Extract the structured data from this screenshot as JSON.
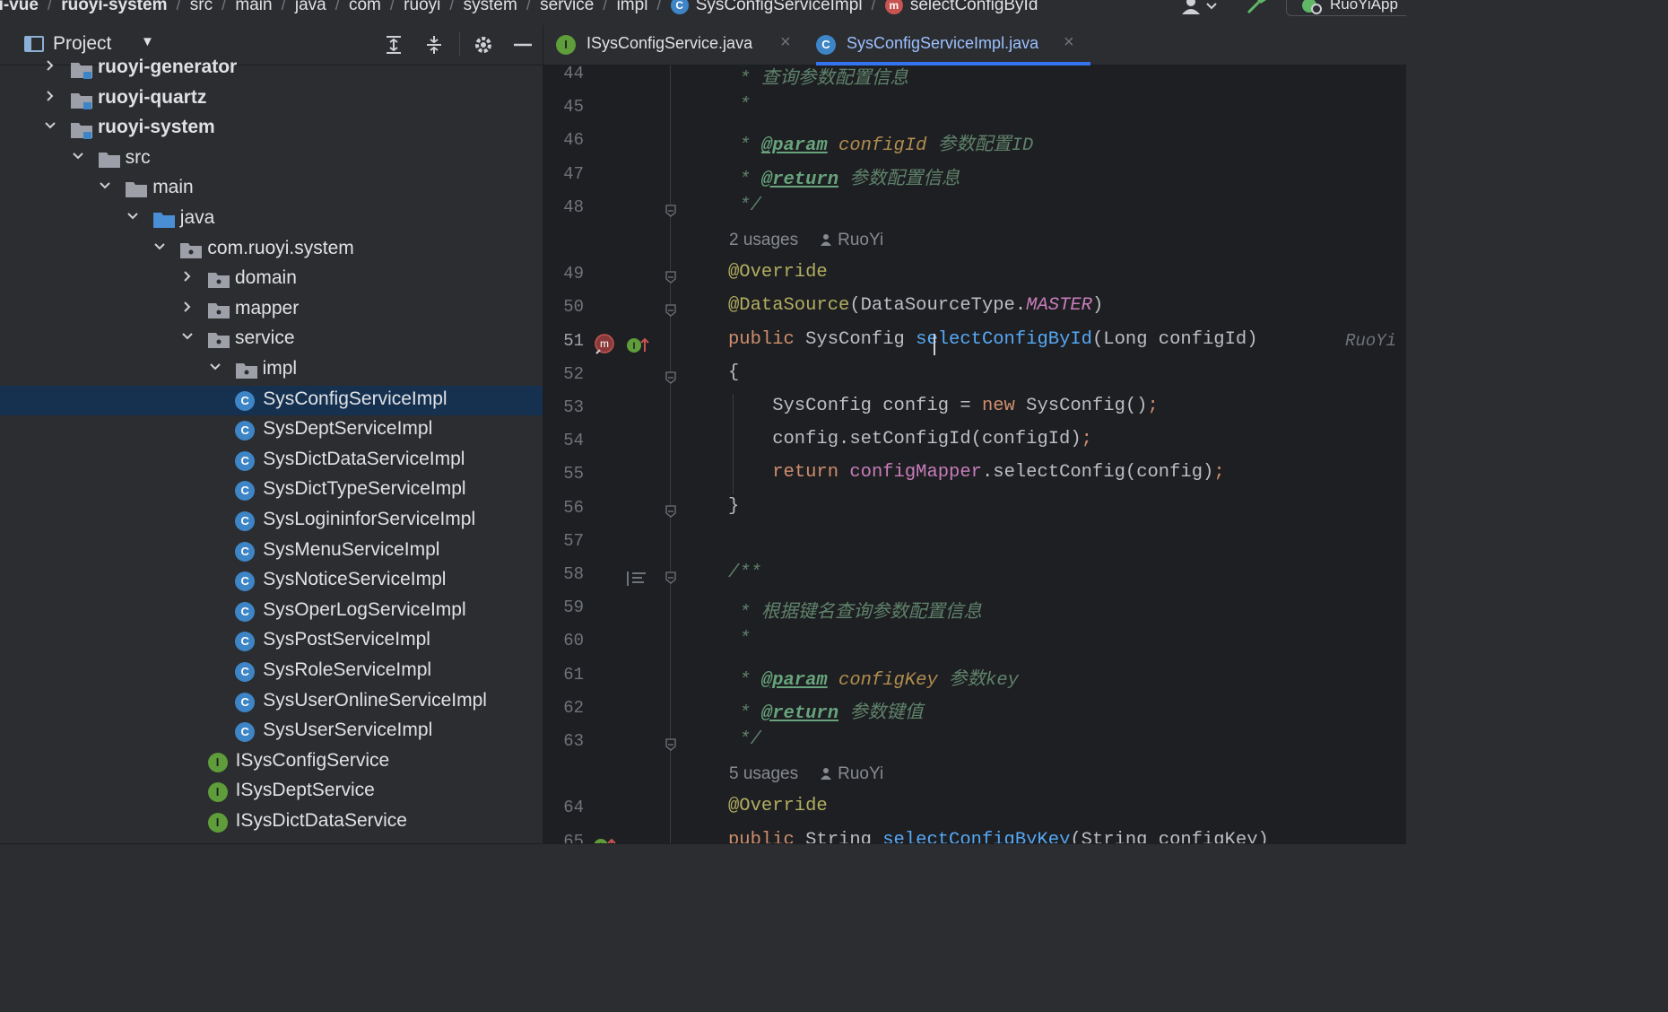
{
  "breadcrumbs": [
    {
      "label": "yi-vue",
      "bold": true
    },
    {
      "label": "ruoyi-system",
      "bold": true
    },
    {
      "label": "src"
    },
    {
      "label": "main"
    },
    {
      "label": "java"
    },
    {
      "label": "com"
    },
    {
      "label": "ruoyi"
    },
    {
      "label": "system"
    },
    {
      "label": "service"
    },
    {
      "label": "impl"
    },
    {
      "label": "SysConfigServiceImpl",
      "icon": "class-icon"
    },
    {
      "label": "selectConfigById",
      "icon": "method-icon"
    }
  ],
  "run_config": {
    "label": "RuoYiApp"
  },
  "project_panel": {
    "title": "Project"
  },
  "tree": [
    {
      "label": "ruoyi-generator",
      "depth": 0,
      "kind": "module",
      "expanded": false,
      "bold": true
    },
    {
      "label": "ruoyi-quartz",
      "depth": 0,
      "kind": "module",
      "expanded": false,
      "bold": true
    },
    {
      "label": "ruoyi-system",
      "depth": 0,
      "kind": "module",
      "expanded": true,
      "bold": true
    },
    {
      "label": "src",
      "depth": 1,
      "kind": "folder",
      "expanded": true
    },
    {
      "label": "main",
      "depth": 2,
      "kind": "folder",
      "expanded": true
    },
    {
      "label": "java",
      "depth": 3,
      "kind": "source-folder",
      "expanded": true
    },
    {
      "label": "com.ruoyi.system",
      "depth": 4,
      "kind": "package",
      "expanded": true
    },
    {
      "label": "domain",
      "depth": 5,
      "kind": "package",
      "expanded": false
    },
    {
      "label": "mapper",
      "depth": 5,
      "kind": "package",
      "expanded": false
    },
    {
      "label": "service",
      "depth": 5,
      "kind": "package",
      "expanded": true
    },
    {
      "label": "impl",
      "depth": 6,
      "kind": "package",
      "expanded": true
    },
    {
      "label": "SysConfigServiceImpl",
      "depth": 7,
      "kind": "class",
      "selected": true
    },
    {
      "label": "SysDeptServiceImpl",
      "depth": 7,
      "kind": "class"
    },
    {
      "label": "SysDictDataServiceImpl",
      "depth": 7,
      "kind": "class"
    },
    {
      "label": "SysDictTypeServiceImpl",
      "depth": 7,
      "kind": "class"
    },
    {
      "label": "SysLogininforServiceImpl",
      "depth": 7,
      "kind": "class"
    },
    {
      "label": "SysMenuServiceImpl",
      "depth": 7,
      "kind": "class"
    },
    {
      "label": "SysNoticeServiceImpl",
      "depth": 7,
      "kind": "class"
    },
    {
      "label": "SysOperLogServiceImpl",
      "depth": 7,
      "kind": "class"
    },
    {
      "label": "SysPostServiceImpl",
      "depth": 7,
      "kind": "class"
    },
    {
      "label": "SysRoleServiceImpl",
      "depth": 7,
      "kind": "class"
    },
    {
      "label": "SysUserOnlineServiceImpl",
      "depth": 7,
      "kind": "class"
    },
    {
      "label": "SysUserServiceImpl",
      "depth": 7,
      "kind": "class"
    },
    {
      "label": "ISysConfigService",
      "depth": 6,
      "kind": "interface"
    },
    {
      "label": "ISysDeptService",
      "depth": 6,
      "kind": "interface"
    },
    {
      "label": "ISysDictDataService",
      "depth": 6,
      "kind": "interface"
    }
  ],
  "tabs": [
    {
      "label": "ISysConfigService.java",
      "kind": "interface",
      "active": false
    },
    {
      "label": "SysConfigServiceImpl.java",
      "kind": "class",
      "active": true
    }
  ],
  "editor": {
    "current_line": 51,
    "lines": [
      {
        "n": 44,
        "tokens": [
          {
            "t": " * 查询参数配置信息",
            "c": "doc"
          }
        ]
      },
      {
        "n": 45,
        "tokens": [
          {
            "t": " *",
            "c": "doc"
          }
        ]
      },
      {
        "n": 46,
        "tokens": [
          {
            "t": " * ",
            "c": "doc"
          },
          {
            "t": "@param",
            "c": "doctag"
          },
          {
            "t": " ",
            "c": "doc"
          },
          {
            "t": "configId",
            "c": "docparam"
          },
          {
            "t": " 参数配置ID",
            "c": "doc"
          }
        ]
      },
      {
        "n": 47,
        "tokens": [
          {
            "t": " * ",
            "c": "doc"
          },
          {
            "t": "@return",
            "c": "doctag"
          },
          {
            "t": " 参数配置信息",
            "c": "doc"
          }
        ]
      },
      {
        "n": 48,
        "tokens": [
          {
            "t": " */",
            "c": "doc"
          }
        ],
        "hint_after": {
          "usages": "2 usages",
          "author": "RuoYi"
        }
      },
      {
        "n": 49,
        "tokens": [
          {
            "t": "@Override",
            "c": "ann"
          }
        ]
      },
      {
        "n": 50,
        "tokens": [
          {
            "t": "@DataSource",
            "c": "ann"
          },
          {
            "t": "(DataSourceType.",
            "c": ""
          },
          {
            "t": "MASTER",
            "c": "const"
          },
          {
            "t": ")",
            "c": ""
          }
        ]
      },
      {
        "n": 51,
        "tokens": [
          {
            "t": "public",
            "c": "kw"
          },
          {
            "t": " SysConfig ",
            "c": ""
          },
          {
            "t": "selectConfigById",
            "c": "fn"
          },
          {
            "t": "(Long configId)",
            "c": ""
          }
        ],
        "inline_author": "RuoYi"
      },
      {
        "n": 52,
        "tokens": [
          {
            "t": "{",
            "c": ""
          }
        ]
      },
      {
        "n": 53,
        "tokens": [
          {
            "t": "    SysConfig config = ",
            "c": ""
          },
          {
            "t": "new",
            "c": "kw"
          },
          {
            "t": " SysConfig()",
            "c": ""
          },
          {
            "t": ";",
            "c": "kw"
          }
        ]
      },
      {
        "n": 54,
        "tokens": [
          {
            "t": "    config.setConfigId(configId)",
            "c": ""
          },
          {
            "t": ";",
            "c": "kw"
          }
        ]
      },
      {
        "n": 55,
        "tokens": [
          {
            "t": "    ",
            "c": ""
          },
          {
            "t": "return",
            "c": "kw"
          },
          {
            "t": " ",
            "c": ""
          },
          {
            "t": "configMapper",
            "c": "field"
          },
          {
            "t": ".selectConfig(config)",
            "c": ""
          },
          {
            "t": ";",
            "c": "kw"
          }
        ]
      },
      {
        "n": 56,
        "tokens": [
          {
            "t": "}",
            "c": ""
          }
        ]
      },
      {
        "n": 57,
        "tokens": []
      },
      {
        "n": 58,
        "tokens": [
          {
            "t": "/**",
            "c": "doc"
          }
        ]
      },
      {
        "n": 59,
        "tokens": [
          {
            "t": " * 根据键名查询参数配置信息",
            "c": "doc"
          }
        ]
      },
      {
        "n": 60,
        "tokens": [
          {
            "t": " *",
            "c": "doc"
          }
        ]
      },
      {
        "n": 61,
        "tokens": [
          {
            "t": " * ",
            "c": "doc"
          },
          {
            "t": "@param",
            "c": "doctag"
          },
          {
            "t": " ",
            "c": "doc"
          },
          {
            "t": "configKey",
            "c": "docparam"
          },
          {
            "t": " 参数key",
            "c": "doc"
          }
        ]
      },
      {
        "n": 62,
        "tokens": [
          {
            "t": " * ",
            "c": "doc"
          },
          {
            "t": "@return",
            "c": "doctag"
          },
          {
            "t": " 参数键值",
            "c": "doc"
          }
        ]
      },
      {
        "n": 63,
        "tokens": [
          {
            "t": " */",
            "c": "doc"
          }
        ],
        "hint_after": {
          "usages": "5 usages",
          "author": "RuoYi"
        }
      },
      {
        "n": 64,
        "tokens": [
          {
            "t": "@Override",
            "c": "ann"
          }
        ]
      },
      {
        "n": 65,
        "tokens": [
          {
            "t": "public",
            "c": "kw"
          },
          {
            "t": " String ",
            "c": ""
          },
          {
            "t": "selectConfigByKey",
            "c": "fn"
          },
          {
            "t": "(String configKey)",
            "c": ""
          }
        ]
      }
    ]
  },
  "colors": {
    "background": "#1e1f22",
    "panel": "#2b2d30",
    "selection": "#163150",
    "accent": "#3574f0",
    "class_icon": "#3d85c6",
    "interface_icon": "#5f9c3a"
  }
}
